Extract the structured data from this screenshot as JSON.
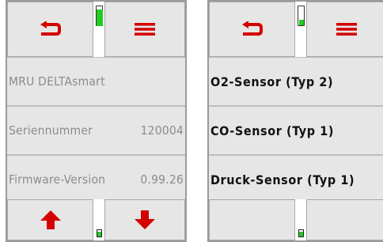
{
  "left_screen": {
    "rows": [
      {
        "label": "MRU DELTAsmart",
        "value": ""
      },
      {
        "label": "Seriennummer",
        "value": "120004"
      },
      {
        "label": "Firmware-Version",
        "value": "0.99.26"
      }
    ]
  },
  "right_screen": {
    "rows": [
      {
        "label": "O2-Sensor (Typ 2)"
      },
      {
        "label": "CO-Sensor (Typ 1)"
      },
      {
        "label": "Druck-Sensor (Typ 1)"
      }
    ]
  },
  "icons": {
    "back": "back-arrow-icon",
    "menu": "hamburger-menu-icon",
    "up": "up-arrow-icon",
    "down": "down-arrow-icon",
    "battery": "battery-icon"
  },
  "colors": {
    "accent_red": "#d40000",
    "battery_green": "#22cc22",
    "button_bg": "#e6e6e6",
    "info_text": "#8c8c8c"
  },
  "battery_level_top_left": 0.85,
  "battery_level_top_right": 0.3
}
